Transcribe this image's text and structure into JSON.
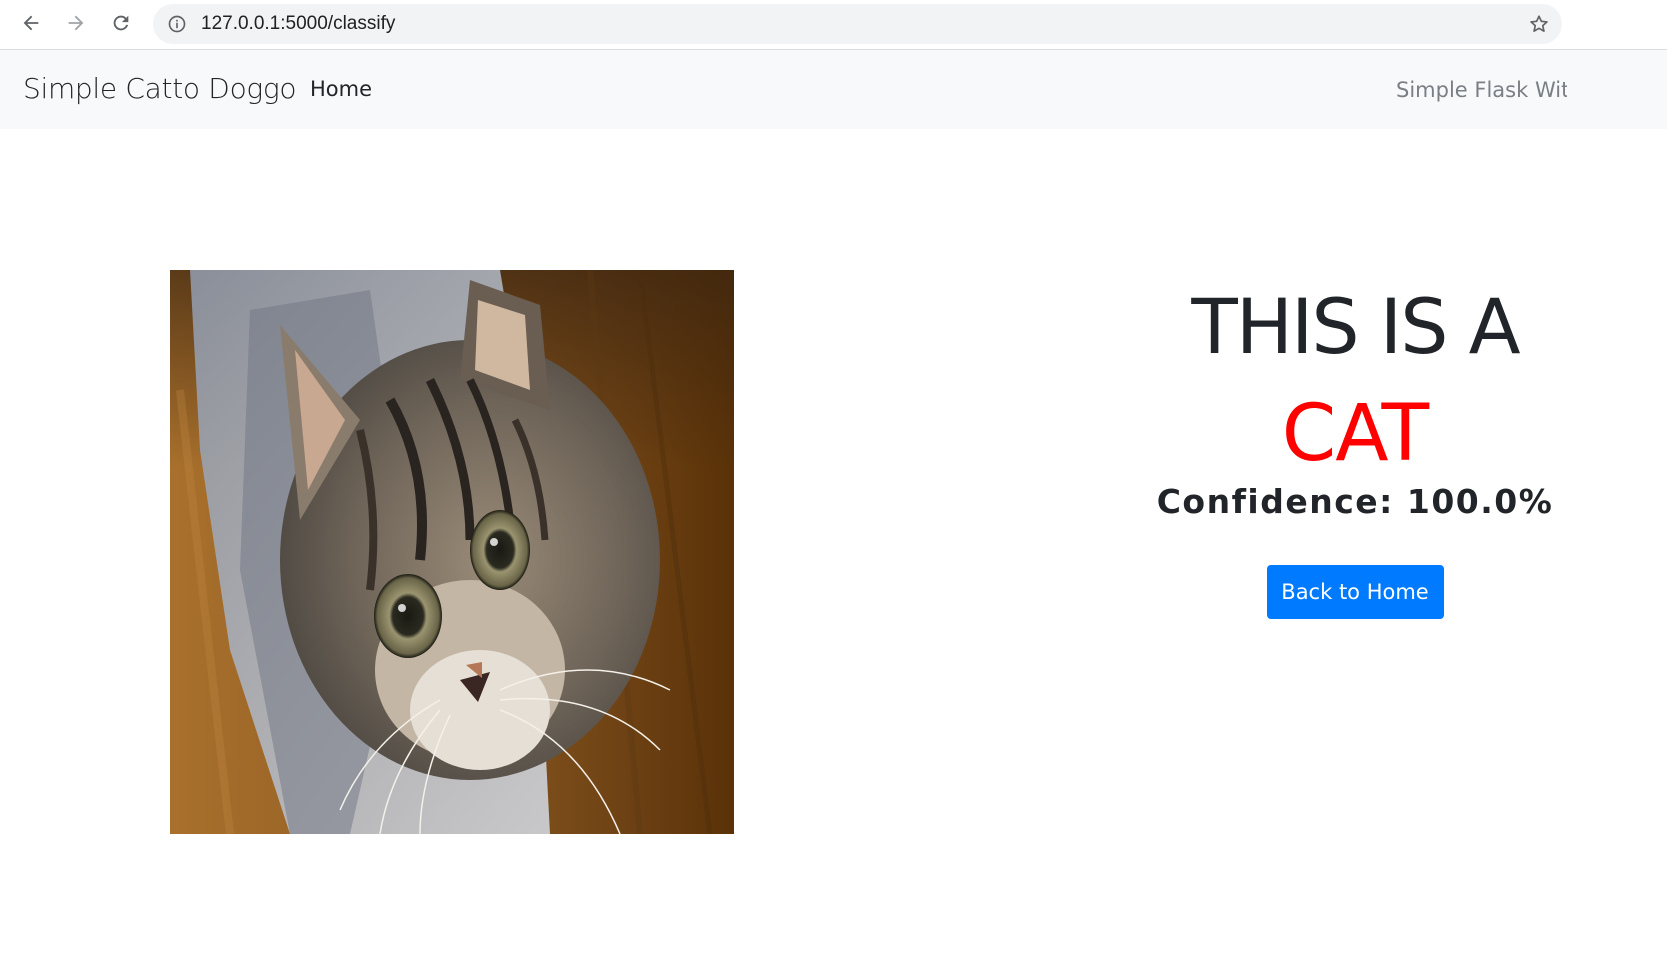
{
  "browser": {
    "url": "127.0.0.1:5000/classify",
    "icons": [
      "back-arrow-icon",
      "forward-arrow-icon",
      "reload-icon",
      "site-info-icon",
      "bookmark-star-icon"
    ]
  },
  "navbar": {
    "brand": "Simple Catto Doggo",
    "home_link": "Home",
    "right_text": "Simple Flask With"
  },
  "result": {
    "line1": "THIS IS A",
    "label": "CAT",
    "label_color": "#ff0000",
    "confidence": "Confidence: 100.0%",
    "back_button": "Back to Home",
    "button_color": "#007bff"
  },
  "image": {
    "subject": "tabby-kitten-photo"
  }
}
